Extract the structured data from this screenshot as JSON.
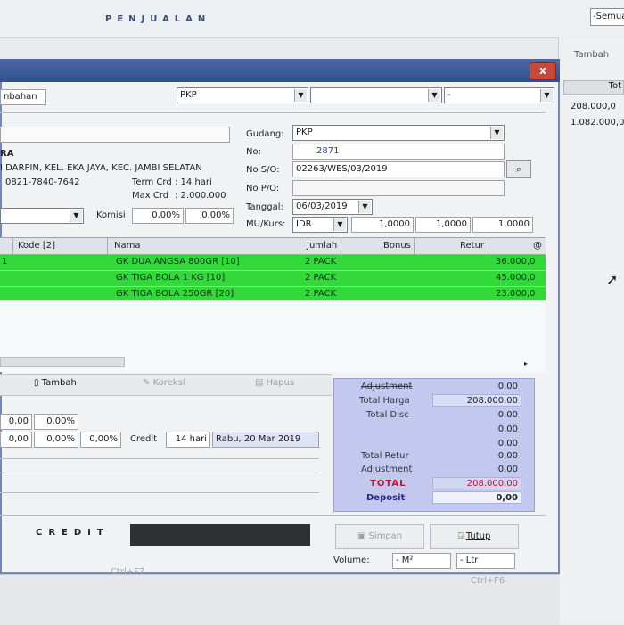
{
  "background": {
    "title": "PENJUALAN",
    "top_combo": "-Semua",
    "right_panel": {
      "tambah": "Tambah",
      "header": "Tot",
      "values": [
        "208.000,0",
        "1.082.000,0"
      ]
    },
    "status_shortcuts": [
      "Ctrl+F7",
      "Ctrl+F6"
    ]
  },
  "dialog": {
    "close": "x",
    "toolbar_row": {
      "tab_label": "nbahan",
      "combo_pkp": "PKP",
      "combo2": "",
      "combo3": "-"
    },
    "customer": {
      "name_fragment": "RA",
      "address": "I DARPIN, KEL. EKA JAYA, KEC. JAMBI SELATAN",
      "phone": "0821-7840-7642",
      "term_label": "Term Crd",
      "term_value": ":  14 hari",
      "max_label": "Max Crd",
      "max_value": ":  2.000.000",
      "komisi_label": "Komisi",
      "komisi_pct1": "0,00%",
      "komisi_pct2": "0,00%"
    },
    "form": {
      "gudang_label": "Gudang:",
      "gudang_value": "PKP",
      "no_label": "No:",
      "no_value": "2871",
      "noso_label": "No S/O:",
      "noso_value": "02263/WES/03/2019",
      "nopo_label": "No P/O:",
      "nopo_value": "",
      "tanggal_label": "Tanggal:",
      "tanggal_value": "06/03/2019",
      "mukurs_label": "MU/Kurs:",
      "mu_value": "IDR",
      "kurs1": "1,0000",
      "kurs2": "1,0000",
      "kurs3": "1,0000"
    },
    "grid": {
      "columns": [
        "Kode [2]",
        "Nama",
        "Jumlah",
        "Bonus",
        "Retur",
        "@"
      ],
      "rows": [
        {
          "lead": "1",
          "nama": "GK DUA ANGSA 800GR [10]",
          "jumlah": "2 PACK",
          "harga": "36.000,0"
        },
        {
          "lead": "",
          "nama": "GK TIGA BOLA 1 KG [10]",
          "jumlah": "2 PACK",
          "harga": "45.000,0"
        },
        {
          "lead": "",
          "nama": "GK TIGA BOLA 250GR [20]",
          "jumlah": "2 PACK",
          "harga": "23.000,0"
        }
      ]
    },
    "toolbar": {
      "tambah": "Tambah",
      "koreksi": "Koreksi",
      "hapus": "Hapus"
    },
    "lower": {
      "r1a": "0,00",
      "r1b": "0,00%",
      "r2a": "0,00",
      "r2b": "0,00%",
      "r2c": "0,00%",
      "credit_label": "Credit",
      "days": "14 hari",
      "due_date": "Rabu, 20 Mar 2019"
    },
    "summary": {
      "adjustment_label": "Adjustment",
      "adjustment_value": "0,00",
      "total_harga_label": "Total Harga",
      "total_harga_value": "208.000,00",
      "total_disc_label": "Total Disc",
      "total_disc_value": "0,00",
      "blank1": "0,00",
      "blank2": "0,00",
      "total_retur_label": "Total Retur",
      "total_retur_value": "0,00",
      "adjustment2_label": "Adjustment",
      "adjustment2_value": "0,00",
      "total_label": "TOTAL",
      "total_value": "208.000,00",
      "deposit_label": "Deposit",
      "deposit_value": "0,00"
    },
    "bottom": {
      "payment_mode": "CREDIT",
      "simpan": "Simpan",
      "tutup": "Tutup",
      "volume_label": "Volume:",
      "m2": "- M²",
      "ltr": "- Ltr"
    },
    "colors": {
      "row_green": "#33d93a",
      "summary_bg": "#c3c8ee",
      "total_red": "#c0142a",
      "deposit_blue": "#2a2a8a"
    }
  }
}
